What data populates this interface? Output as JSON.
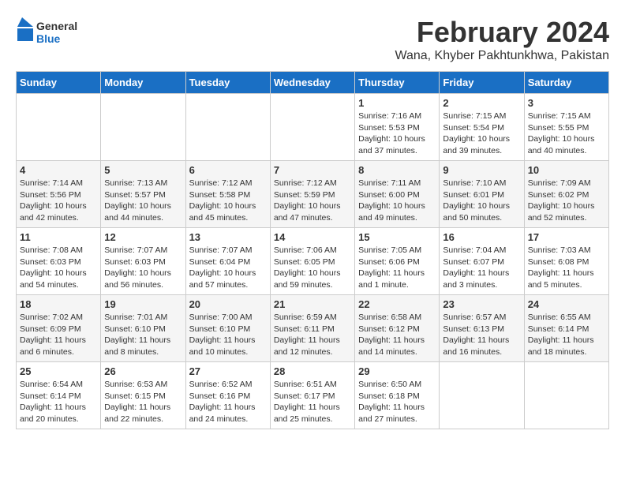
{
  "logo": {
    "text_general": "General",
    "text_blue": "Blue"
  },
  "title": {
    "month_year": "February 2024",
    "location": "Wana, Khyber Pakhtunkhwa, Pakistan"
  },
  "weekdays": [
    "Sunday",
    "Monday",
    "Tuesday",
    "Wednesday",
    "Thursday",
    "Friday",
    "Saturday"
  ],
  "weeks": [
    [
      {
        "day": "",
        "info": ""
      },
      {
        "day": "",
        "info": ""
      },
      {
        "day": "",
        "info": ""
      },
      {
        "day": "",
        "info": ""
      },
      {
        "day": "1",
        "info": "Sunrise: 7:16 AM\nSunset: 5:53 PM\nDaylight: 10 hours and 37 minutes."
      },
      {
        "day": "2",
        "info": "Sunrise: 7:15 AM\nSunset: 5:54 PM\nDaylight: 10 hours and 39 minutes."
      },
      {
        "day": "3",
        "info": "Sunrise: 7:15 AM\nSunset: 5:55 PM\nDaylight: 10 hours and 40 minutes."
      }
    ],
    [
      {
        "day": "4",
        "info": "Sunrise: 7:14 AM\nSunset: 5:56 PM\nDaylight: 10 hours and 42 minutes."
      },
      {
        "day": "5",
        "info": "Sunrise: 7:13 AM\nSunset: 5:57 PM\nDaylight: 10 hours and 44 minutes."
      },
      {
        "day": "6",
        "info": "Sunrise: 7:12 AM\nSunset: 5:58 PM\nDaylight: 10 hours and 45 minutes."
      },
      {
        "day": "7",
        "info": "Sunrise: 7:12 AM\nSunset: 5:59 PM\nDaylight: 10 hours and 47 minutes."
      },
      {
        "day": "8",
        "info": "Sunrise: 7:11 AM\nSunset: 6:00 PM\nDaylight: 10 hours and 49 minutes."
      },
      {
        "day": "9",
        "info": "Sunrise: 7:10 AM\nSunset: 6:01 PM\nDaylight: 10 hours and 50 minutes."
      },
      {
        "day": "10",
        "info": "Sunrise: 7:09 AM\nSunset: 6:02 PM\nDaylight: 10 hours and 52 minutes."
      }
    ],
    [
      {
        "day": "11",
        "info": "Sunrise: 7:08 AM\nSunset: 6:03 PM\nDaylight: 10 hours and 54 minutes."
      },
      {
        "day": "12",
        "info": "Sunrise: 7:07 AM\nSunset: 6:03 PM\nDaylight: 10 hours and 56 minutes."
      },
      {
        "day": "13",
        "info": "Sunrise: 7:07 AM\nSunset: 6:04 PM\nDaylight: 10 hours and 57 minutes."
      },
      {
        "day": "14",
        "info": "Sunrise: 7:06 AM\nSunset: 6:05 PM\nDaylight: 10 hours and 59 minutes."
      },
      {
        "day": "15",
        "info": "Sunrise: 7:05 AM\nSunset: 6:06 PM\nDaylight: 11 hours and 1 minute."
      },
      {
        "day": "16",
        "info": "Sunrise: 7:04 AM\nSunset: 6:07 PM\nDaylight: 11 hours and 3 minutes."
      },
      {
        "day": "17",
        "info": "Sunrise: 7:03 AM\nSunset: 6:08 PM\nDaylight: 11 hours and 5 minutes."
      }
    ],
    [
      {
        "day": "18",
        "info": "Sunrise: 7:02 AM\nSunset: 6:09 PM\nDaylight: 11 hours and 6 minutes."
      },
      {
        "day": "19",
        "info": "Sunrise: 7:01 AM\nSunset: 6:10 PM\nDaylight: 11 hours and 8 minutes."
      },
      {
        "day": "20",
        "info": "Sunrise: 7:00 AM\nSunset: 6:10 PM\nDaylight: 11 hours and 10 minutes."
      },
      {
        "day": "21",
        "info": "Sunrise: 6:59 AM\nSunset: 6:11 PM\nDaylight: 11 hours and 12 minutes."
      },
      {
        "day": "22",
        "info": "Sunrise: 6:58 AM\nSunset: 6:12 PM\nDaylight: 11 hours and 14 minutes."
      },
      {
        "day": "23",
        "info": "Sunrise: 6:57 AM\nSunset: 6:13 PM\nDaylight: 11 hours and 16 minutes."
      },
      {
        "day": "24",
        "info": "Sunrise: 6:55 AM\nSunset: 6:14 PM\nDaylight: 11 hours and 18 minutes."
      }
    ],
    [
      {
        "day": "25",
        "info": "Sunrise: 6:54 AM\nSunset: 6:14 PM\nDaylight: 11 hours and 20 minutes."
      },
      {
        "day": "26",
        "info": "Sunrise: 6:53 AM\nSunset: 6:15 PM\nDaylight: 11 hours and 22 minutes."
      },
      {
        "day": "27",
        "info": "Sunrise: 6:52 AM\nSunset: 6:16 PM\nDaylight: 11 hours and 24 minutes."
      },
      {
        "day": "28",
        "info": "Sunrise: 6:51 AM\nSunset: 6:17 PM\nDaylight: 11 hours and 25 minutes."
      },
      {
        "day": "29",
        "info": "Sunrise: 6:50 AM\nSunset: 6:18 PM\nDaylight: 11 hours and 27 minutes."
      },
      {
        "day": "",
        "info": ""
      },
      {
        "day": "",
        "info": ""
      }
    ]
  ]
}
